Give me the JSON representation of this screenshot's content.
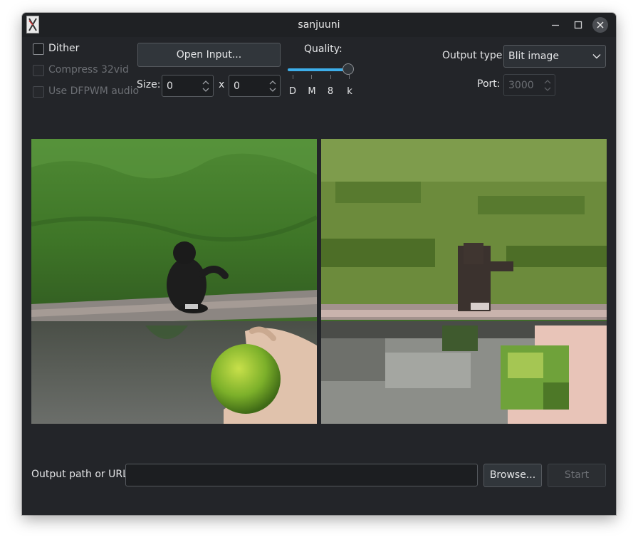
{
  "window": {
    "title": "sanjuuni"
  },
  "options": {
    "dither_label": "Dither",
    "dither_checked": false,
    "compress_label": "Compress 32vid",
    "compress_enabled": false,
    "dfpwm_label": "Use DFPWM audio",
    "dfpwm_enabled": false
  },
  "input": {
    "open_button": "Open Input...",
    "size_label": "Size:",
    "width_value": "0",
    "x_label": "x",
    "height_value": "0"
  },
  "quality": {
    "label": "Quality:",
    "ticks": [
      "D",
      "M",
      "8",
      "k"
    ],
    "selected": "k",
    "level": 1.0
  },
  "output": {
    "type_label": "Output type:",
    "type_value": "Blit image",
    "port_label": "Port:",
    "port_value": "3000",
    "port_enabled": false,
    "path_label": "Output path or URL:",
    "path_value": "",
    "browse_button": "Browse...",
    "start_button": "Start",
    "start_enabled": false
  },
  "previews": {
    "left": "original",
    "right": "dithered"
  },
  "icons": {
    "app": "app-icon",
    "minimize": "minimize-icon",
    "maximize": "maximize-icon",
    "close": "close-icon",
    "combo": "chevron-down-icon"
  }
}
